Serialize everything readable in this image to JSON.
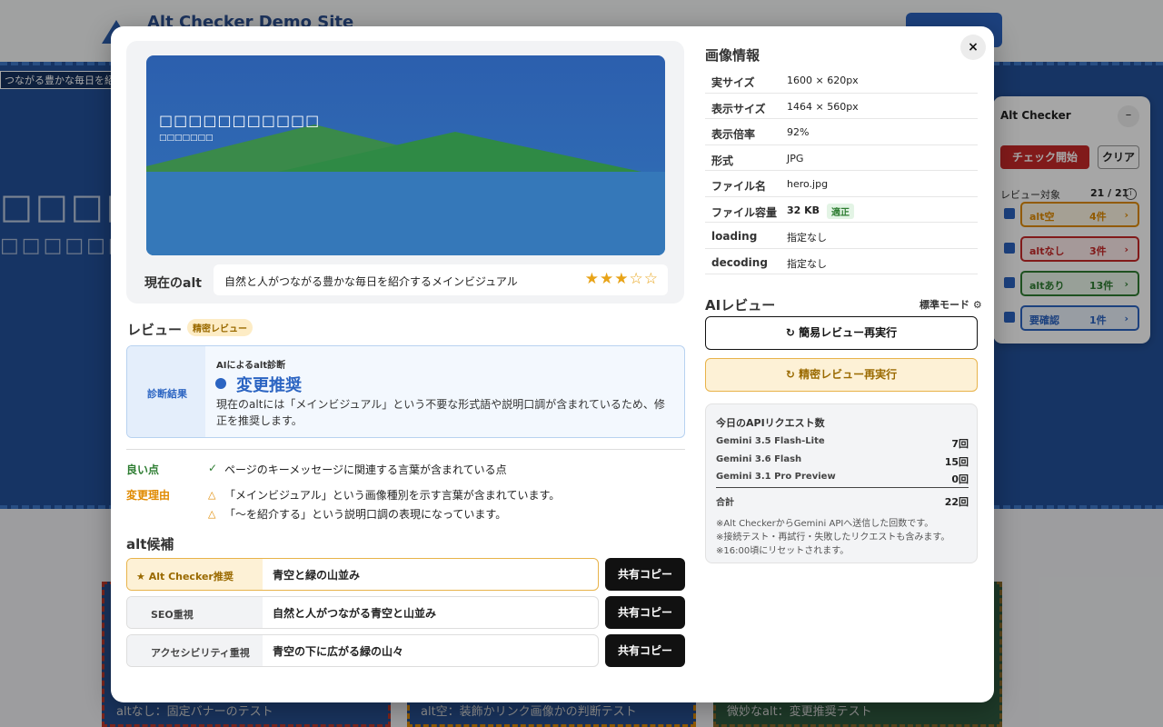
{
  "background": {
    "site_title": "Alt Checker Demo Site",
    "hero_label": "つながる豊かな毎日を紹",
    "cards": [
      {
        "caption": "altなし：固定バナーのテスト"
      },
      {
        "caption": "alt空：装飾かリンク画像かの判断テスト"
      },
      {
        "caption": "微妙なalt：変更推奨テスト"
      }
    ]
  },
  "widget": {
    "title": "Alt Checker",
    "minimize_label": "–",
    "start_label": "チェック開始",
    "clear_label": "クリア",
    "target_label": "レビュー対象",
    "target_count": "21 / 21",
    "info_icon": "i",
    "filters": [
      {
        "label": "alt空",
        "count": "4件",
        "color": "#e08a00",
        "bg": "#fdf6e3"
      },
      {
        "label": "altなし",
        "count": "3件",
        "color": "#c62828",
        "bg": "#fdecec"
      },
      {
        "label": "altあり",
        "count": "13件",
        "color": "#2e7d32",
        "bg": "#eaf6ea"
      },
      {
        "label": "要確認",
        "count": "1件",
        "color": "#2b64c2",
        "bg": "#eaf1fb"
      }
    ],
    "chevron": "›"
  },
  "modal": {
    "close_icon": "×",
    "preview": {
      "tofu_line1": "□□□□□□□□□□□",
      "tofu_line2": "□□□□□□□",
      "current_alt_label": "現在のalt",
      "current_alt_text": "自然と人がつながる豊かな毎日を紹介するメインビジュアル",
      "rating": 3,
      "rating_max": 5,
      "stars_text": "★★★☆☆"
    },
    "review": {
      "title": "レビュー",
      "mode_badge": "精密レビュー",
      "diag_label": "診断結果",
      "diag_sub": "AIによるalt診断",
      "diag_result": "変更推奨",
      "diag_desc": "現在のaltには「メインビジュアル」という不要な形式語や説明口調が含まれているため、修正を推奨します。",
      "good_label": "良い点",
      "good_icon": "✓",
      "good_text": "ページのキーメッセージに関連する言葉が含まれている点",
      "change_label": "変更理由",
      "change_icon": "△",
      "change_items": [
        "「メインビジュアル」という画像種別を示す言葉が含まれています。",
        "「〜を紹介する」という説明口調の表現になっています。"
      ]
    },
    "candidates": {
      "title": "alt候補",
      "copy_label": "共有コピー",
      "items": [
        {
          "label": "★ Alt Checker推奨",
          "value": "青空と緑の山並み",
          "recommended": true
        },
        {
          "label": "SEO重視",
          "value": "自然と人がつながる青空と山並み",
          "recommended": false
        },
        {
          "label": "アクセシビリティ重視",
          "value": "青空の下に広がる緑の山々",
          "recommended": false
        }
      ]
    },
    "image_info": {
      "title": "画像情報",
      "rows": [
        {
          "key": "実サイズ",
          "value": "1600 × 620px"
        },
        {
          "key": "表示サイズ",
          "value": "1464 × 560px"
        },
        {
          "key": "表示倍率",
          "value": "92%"
        },
        {
          "key": "形式",
          "value": "JPG"
        },
        {
          "key": "ファイル名",
          "value": "hero.jpg"
        },
        {
          "key": "ファイル容量",
          "value": "32 KB",
          "badge": "適正"
        },
        {
          "key": "loading",
          "value": "指定なし"
        },
        {
          "key": "decoding",
          "value": "指定なし"
        }
      ]
    },
    "ai_review": {
      "title": "AIレビュー",
      "mode": "標準モード ⚙",
      "simple_button": "↻ 簡易レビュー再実行",
      "precise_button": "↻ 精密レビュー再実行"
    },
    "api": {
      "title": "今日のAPIリクエスト数",
      "rows": [
        {
          "name": "Gemini 3.5 Flash-Lite",
          "count": "7回"
        },
        {
          "name": "Gemini 3.6 Flash",
          "count": "15回"
        },
        {
          "name": "Gemini 3.1 Pro Preview",
          "count": "0回"
        }
      ],
      "total_label": "合計",
      "total_value": "22回",
      "notes": [
        "※Alt CheckerからGemini APIへ送信した回数です。",
        "※接続テスト・再試行・失敗したリクエストも含みます。",
        "※16:00頃にリセットされます。"
      ]
    }
  }
}
